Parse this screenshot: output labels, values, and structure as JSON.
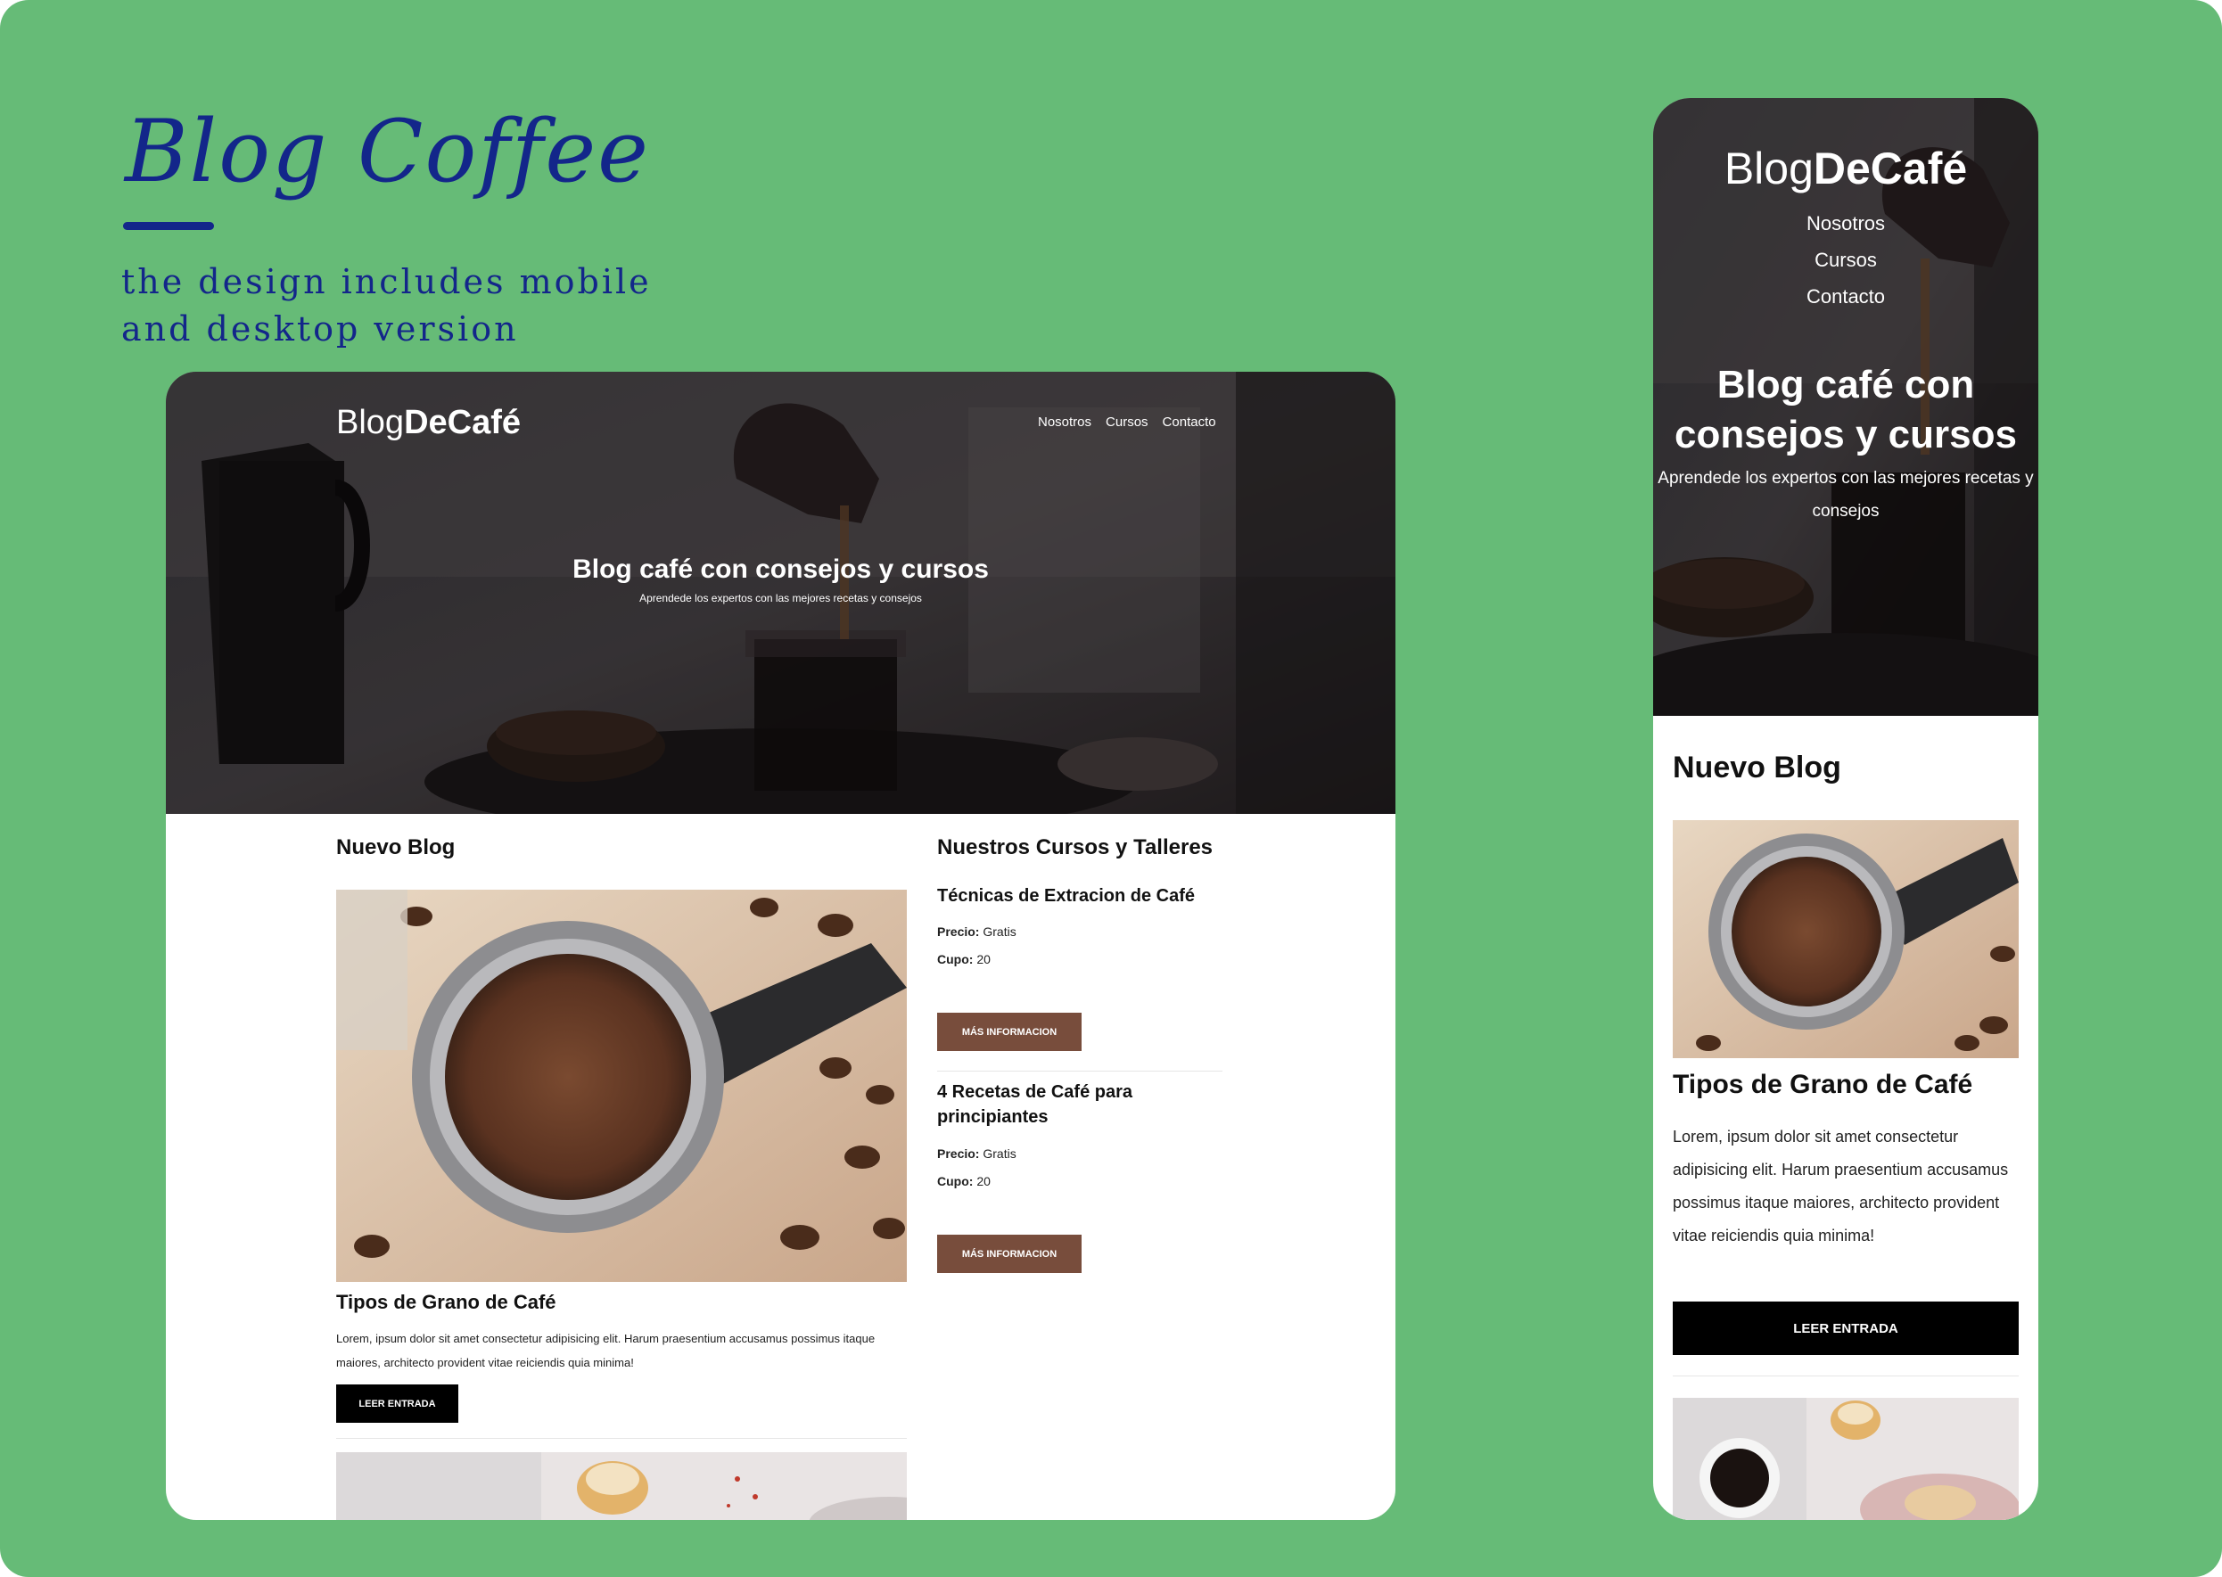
{
  "presentation": {
    "title": "Blog Coffee",
    "subtitle_line1": "the design includes mobile",
    "subtitle_line2": "and desktop version"
  },
  "site": {
    "logo_light": "Blog",
    "logo_bold": "DeCafé",
    "nav": [
      "Nosotros",
      "Cursos",
      "Contacto"
    ],
    "hero_title": "Blog café con consejos y cursos",
    "hero_subtitle": "Aprendede los expertos con las mejores recetas y consejos",
    "blog_heading": "Nuevo Blog",
    "post_title": "Tipos de Grano de Café",
    "post_excerpt": "Lorem, ipsum dolor sit amet consectetur adipisicing elit. Harum praesentium accusamus possimus itaque maiores, architecto provident vitae reiciendis quia minima!",
    "read_button": "LEER ENTRADA",
    "courses_heading": "Nuestros Cursos y Talleres",
    "courses": [
      {
        "title": "Técnicas de Extracion de Café",
        "price_label": "Precio:",
        "price": "Gratis",
        "seats_label": "Cupo:",
        "seats": "20",
        "button": "MÁS INFORMACION"
      },
      {
        "title": "4 Recetas de Café para principiantes",
        "price_label": "Precio:",
        "price": "Gratis",
        "seats_label": "Cupo:",
        "seats": "20",
        "button": "MÁS INFORMACION"
      }
    ]
  },
  "colors": {
    "background": "#66bb77",
    "accent_text": "#13268a",
    "button_brown": "#784d3c",
    "button_black": "#000000"
  },
  "icons": {
    "hero_image": "coffee-pour-photo",
    "post_image": "espresso-portafilter-photo",
    "post2_image": "coffee-cupcakes-photo"
  }
}
